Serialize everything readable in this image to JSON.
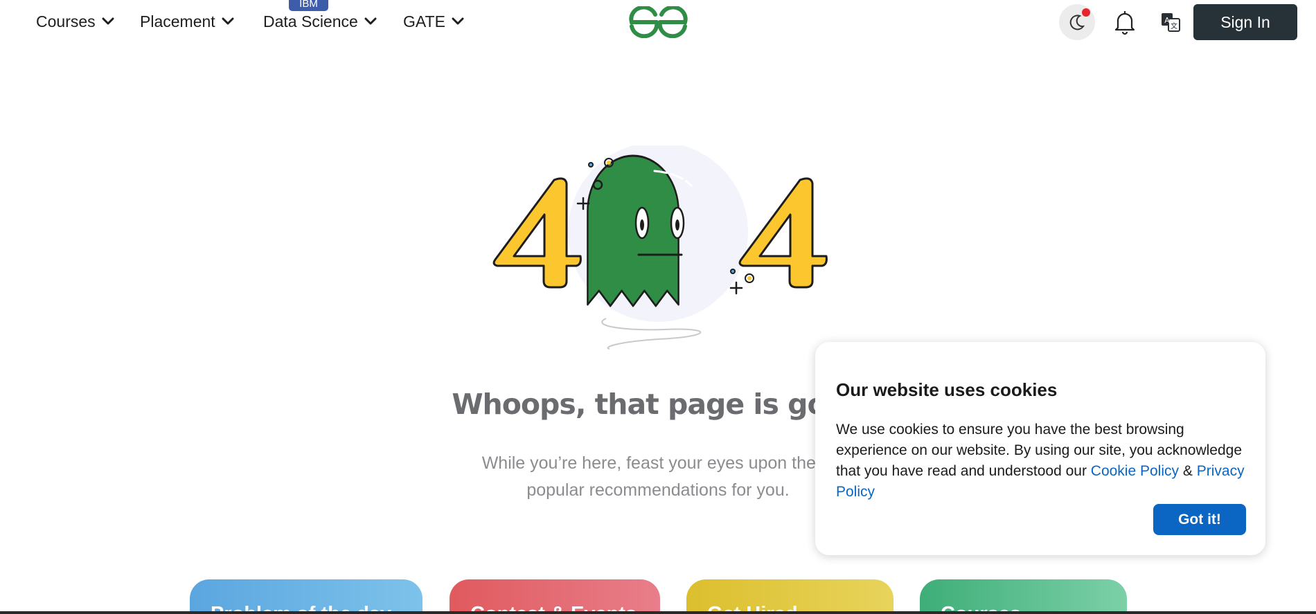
{
  "nav": {
    "items": [
      {
        "label": "Courses"
      },
      {
        "label": "Placement"
      },
      {
        "label": "Data Science",
        "badge": "IBM"
      },
      {
        "label": "GATE"
      }
    ],
    "signin_label": "Sign In"
  },
  "error_page": {
    "illustration": "404-ghost",
    "headline": "Whoops, that page is gone",
    "subtext_line1": "While you’re here, feast your eyes upon these",
    "subtext_line2": "popular recommendations for you."
  },
  "cards": [
    {
      "title": "Problem of the day",
      "color_from": "#5ba6e0",
      "color_to": "#7dc2ea"
    },
    {
      "title": "Contest & Events",
      "color_from": "#e05a5e",
      "color_to": "#e87e8a"
    },
    {
      "title": "Get Hired",
      "color_from": "#dcbf2e",
      "color_to": "#e8d45c"
    },
    {
      "title": "Courses",
      "color_from": "#3eae78",
      "color_to": "#7cd0a8"
    }
  ],
  "cookie": {
    "title": "Our website uses cookies",
    "body_text": "We use cookies to ensure you have the best browsing experience on our website. By using our site, you acknowledge that you have read and understood our",
    "cookie_policy_link": "Cookie Policy",
    "ampersand": "&",
    "privacy_policy_link": "Privacy Policy",
    "accept_label": "Got it!"
  },
  "colors": {
    "brand_green": "#2f8d46",
    "primary_blue": "#0a66c2",
    "signin_bg": "#263238",
    "badge_blue": "#3d5dab",
    "four_yellow": "#fcc72e"
  },
  "icons": [
    "chevron-down-icon",
    "geeksforgeeks-logo",
    "moon-icon",
    "bell-icon",
    "translate-icon"
  ]
}
